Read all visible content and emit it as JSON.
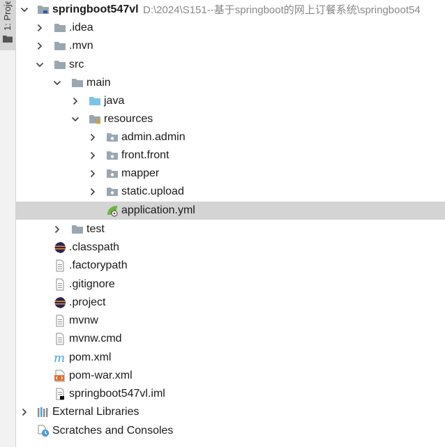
{
  "sidebar": {
    "tab_label": "1: Proje"
  },
  "tree": {
    "root": {
      "label": "springboot547vl",
      "path": "D:\\2024\\S151--基于springboot的网上订餐系统\\springboot54"
    },
    "nodes": [
      {
        "label": ".idea",
        "icon": "folder-icon"
      },
      {
        "label": ".mvn",
        "icon": "folder-icon"
      },
      {
        "label": "src",
        "icon": "folder-icon"
      },
      {
        "label": "main",
        "icon": "folder-icon"
      },
      {
        "label": "java",
        "icon": "source-folder-icon"
      },
      {
        "label": "resources",
        "icon": "resources-folder-icon"
      },
      {
        "label": "admin.admin",
        "icon": "package-icon"
      },
      {
        "label": "front.front",
        "icon": "package-icon"
      },
      {
        "label": "mapper",
        "icon": "package-icon"
      },
      {
        "label": "static.upload",
        "icon": "package-icon"
      },
      {
        "label": "application.yml",
        "icon": "spring-config-icon"
      },
      {
        "label": "test",
        "icon": "folder-icon"
      },
      {
        "label": ".classpath",
        "icon": "eclipse-icon"
      },
      {
        "label": ".factorypath",
        "icon": "text-file-icon"
      },
      {
        "label": ".gitignore",
        "icon": "text-file-icon"
      },
      {
        "label": ".project",
        "icon": "eclipse-icon"
      },
      {
        "label": "mvnw",
        "icon": "text-file-icon"
      },
      {
        "label": "mvnw.cmd",
        "icon": "text-file-icon"
      },
      {
        "label": "pom.xml",
        "icon": "maven-icon"
      },
      {
        "label": "pom-war.xml",
        "icon": "xml-file-icon"
      },
      {
        "label": "springboot547vl.iml",
        "icon": "iml-file-icon"
      },
      {
        "label": "External Libraries",
        "icon": "library-icon"
      },
      {
        "label": "Scratches and Consoles",
        "icon": "scratches-icon"
      }
    ]
  },
  "colors": {
    "selection": "#d4d4d4",
    "folder": "#9aa7b0",
    "source_folder": "#7ec3e6",
    "path_text": "#888888",
    "maven": "#4a9fd8",
    "xml": "#e06b2e",
    "spring": "#6db33f"
  }
}
